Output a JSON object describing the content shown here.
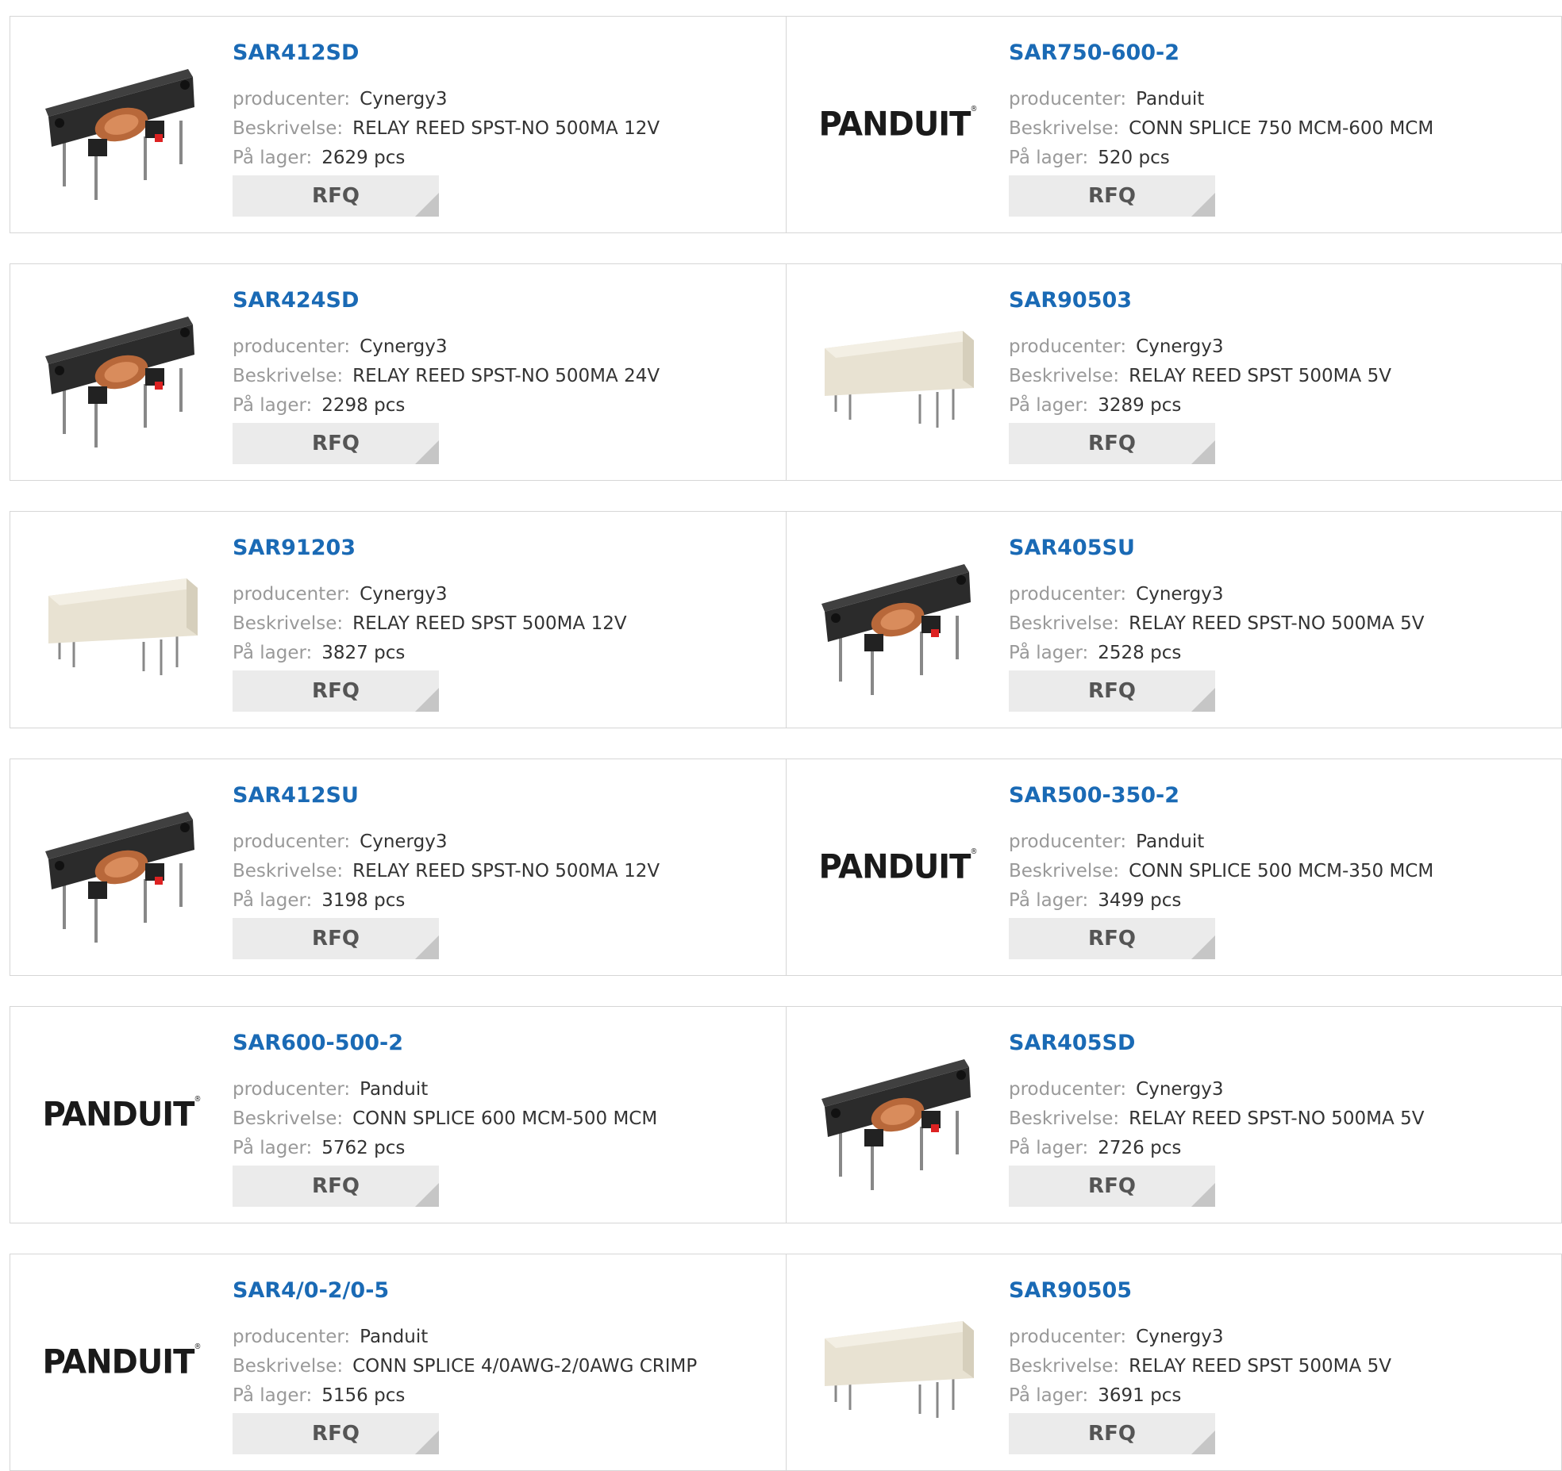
{
  "labels": {
    "manufacturer": "producenter:",
    "description": "Beskrivelse:",
    "stock": "På lager:",
    "rfq": "RFQ",
    "brand_logo": "PANDUIT"
  },
  "colors": {
    "title_link": "#1a6ab5",
    "label_gray": "#999999",
    "value_text": "#333333",
    "rfq_bg": "#ebebeb"
  },
  "products": [
    {
      "part": "SAR412SD",
      "manufacturer": "Cynergy3",
      "description": "RELAY REED SPST-NO 500MA 12V",
      "stock": "2629 pcs",
      "image": "reed-relay-black"
    },
    {
      "part": "SAR750-600-2",
      "manufacturer": "Panduit",
      "description": "CONN SPLICE 750 MCM-600 MCM",
      "stock": "520 pcs",
      "image": "panduit-logo"
    },
    {
      "part": "SAR424SD",
      "manufacturer": "Cynergy3",
      "description": "RELAY REED SPST-NO 500MA 24V",
      "stock": "2298 pcs",
      "image": "reed-relay-black"
    },
    {
      "part": "SAR90503",
      "manufacturer": "Cynergy3",
      "description": "RELAY REED SPST 500MA 5V",
      "stock": "3289 pcs",
      "image": "reed-relay-white"
    },
    {
      "part": "SAR91203",
      "manufacturer": "Cynergy3",
      "description": "RELAY REED SPST 500MA 12V",
      "stock": "3827 pcs",
      "image": "reed-relay-white"
    },
    {
      "part": "SAR405SU",
      "manufacturer": "Cynergy3",
      "description": "RELAY REED SPST-NO 500MA 5V",
      "stock": "2528 pcs",
      "image": "reed-relay-black"
    },
    {
      "part": "SAR412SU",
      "manufacturer": "Cynergy3",
      "description": "RELAY REED SPST-NO 500MA 12V",
      "stock": "3198 pcs",
      "image": "reed-relay-black"
    },
    {
      "part": "SAR500-350-2",
      "manufacturer": "Panduit",
      "description": "CONN SPLICE 500 MCM-350 MCM",
      "stock": "3499 pcs",
      "image": "panduit-logo"
    },
    {
      "part": "SAR600-500-2",
      "manufacturer": "Panduit",
      "description": "CONN SPLICE 600 MCM-500 MCM",
      "stock": "5762 pcs",
      "image": "panduit-logo"
    },
    {
      "part": "SAR405SD",
      "manufacturer": "Cynergy3",
      "description": "RELAY REED SPST-NO 500MA 5V",
      "stock": "2726 pcs",
      "image": "reed-relay-black"
    },
    {
      "part": "SAR4/0-2/0-5",
      "manufacturer": "Panduit",
      "description": "CONN SPLICE 4/0AWG-2/0AWG CRIMP",
      "stock": "5156 pcs",
      "image": "panduit-logo"
    },
    {
      "part": "SAR90505",
      "manufacturer": "Cynergy3",
      "description": "RELAY REED SPST 500MA 5V",
      "stock": "3691 pcs",
      "image": "reed-relay-white"
    }
  ]
}
